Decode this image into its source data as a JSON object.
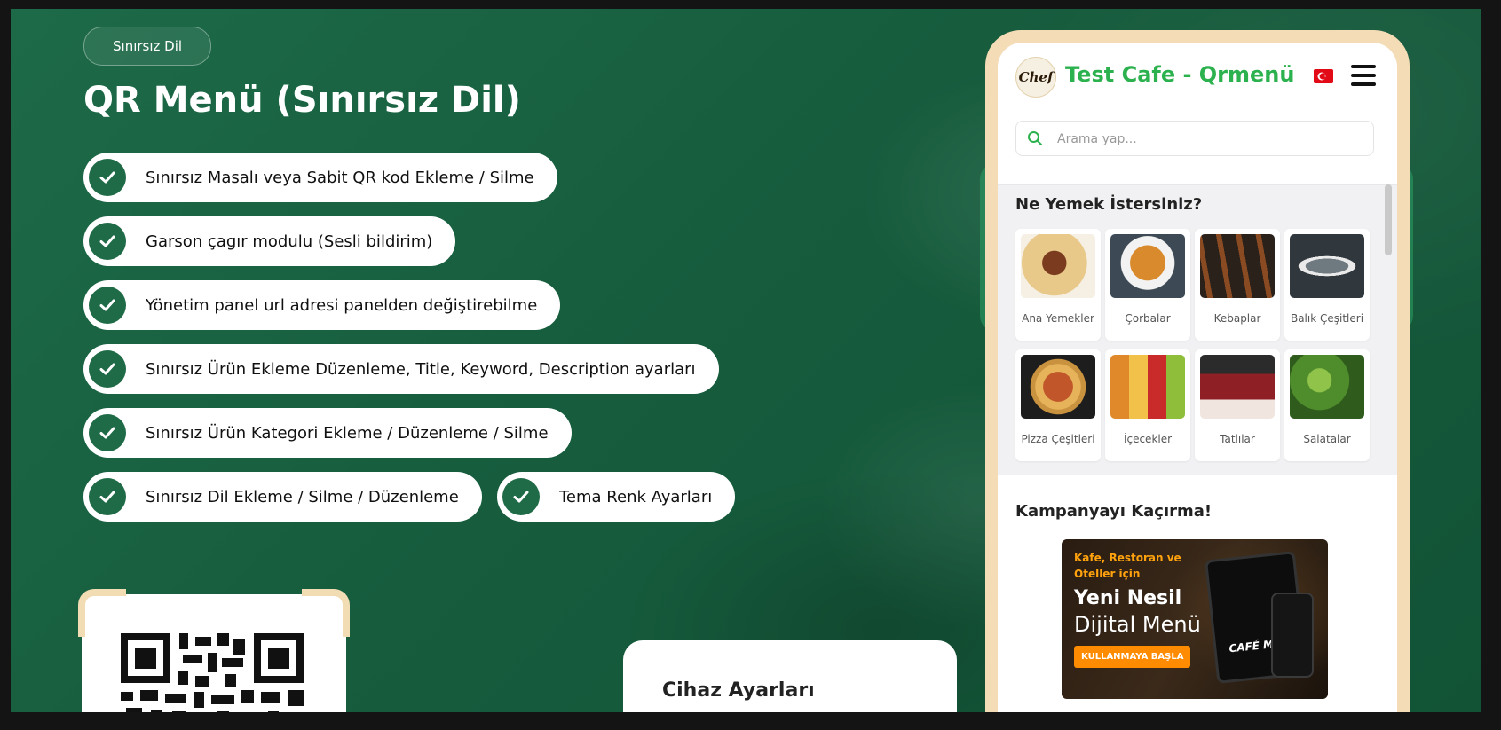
{
  "badge": "Sınırsız Dil",
  "page_title": "QR Menü (Sınırsız Dil)",
  "features": [
    "Sınırsız Masalı veya Sabit QR kod Ekleme / Silme",
    "Garson çagır modulu (Sesli bildirim)",
    "Yönetim panel url adresi panelden değiştirebilme",
    "Sınırsız Ürün Ekleme Düzenleme, Title, Keyword, Description ayarları",
    "Sınırsız Ürün Kategori Ekleme / Düzenleme / Silme",
    "Sınırsız Dil Ekleme / Silme / Düzenleme",
    "Tema Renk Ayarları"
  ],
  "device_card_title": "Cihaz Ayarları",
  "phone": {
    "logo_text": "Chef",
    "app_title": "Test Cafe - Qrmenü",
    "search_placeholder": "Arama yap...",
    "categories_title": "Ne Yemek İstersiniz?",
    "categories": [
      {
        "label": "Ana Yemekler",
        "color": "#c9a56a"
      },
      {
        "label": "Çorbalar",
        "color": "#d98a2c"
      },
      {
        "label": "Kebaplar",
        "color": "#6b4a2a"
      },
      {
        "label": "Balık Çeşitleri",
        "color": "#8a8f92"
      },
      {
        "label": "Pizza Çeşitleri",
        "color": "#c0562a"
      },
      {
        "label": "İçecekler",
        "color": "#e0892a"
      },
      {
        "label": "Tatlılar",
        "color": "#8e1f24"
      },
      {
        "label": "Salatalar",
        "color": "#4f8d2c"
      }
    ],
    "campaign_title": "Kampanyayı Kaçırma!",
    "banner": {
      "top_text": "Kafe, Restoran ve Oteller için",
      "headline": "Yeni Nesil",
      "subline": "Dijital Menü",
      "cta": "KULLANMAYA BAŞLA",
      "brand": "CAFÉ MENÜ"
    }
  },
  "colors": {
    "background_green": "#1d6a48",
    "check_green": "#1f6b47",
    "brand_green": "#2bb14e",
    "frame_cream": "#f4dcb6",
    "cta_orange": "#ff8b00"
  }
}
